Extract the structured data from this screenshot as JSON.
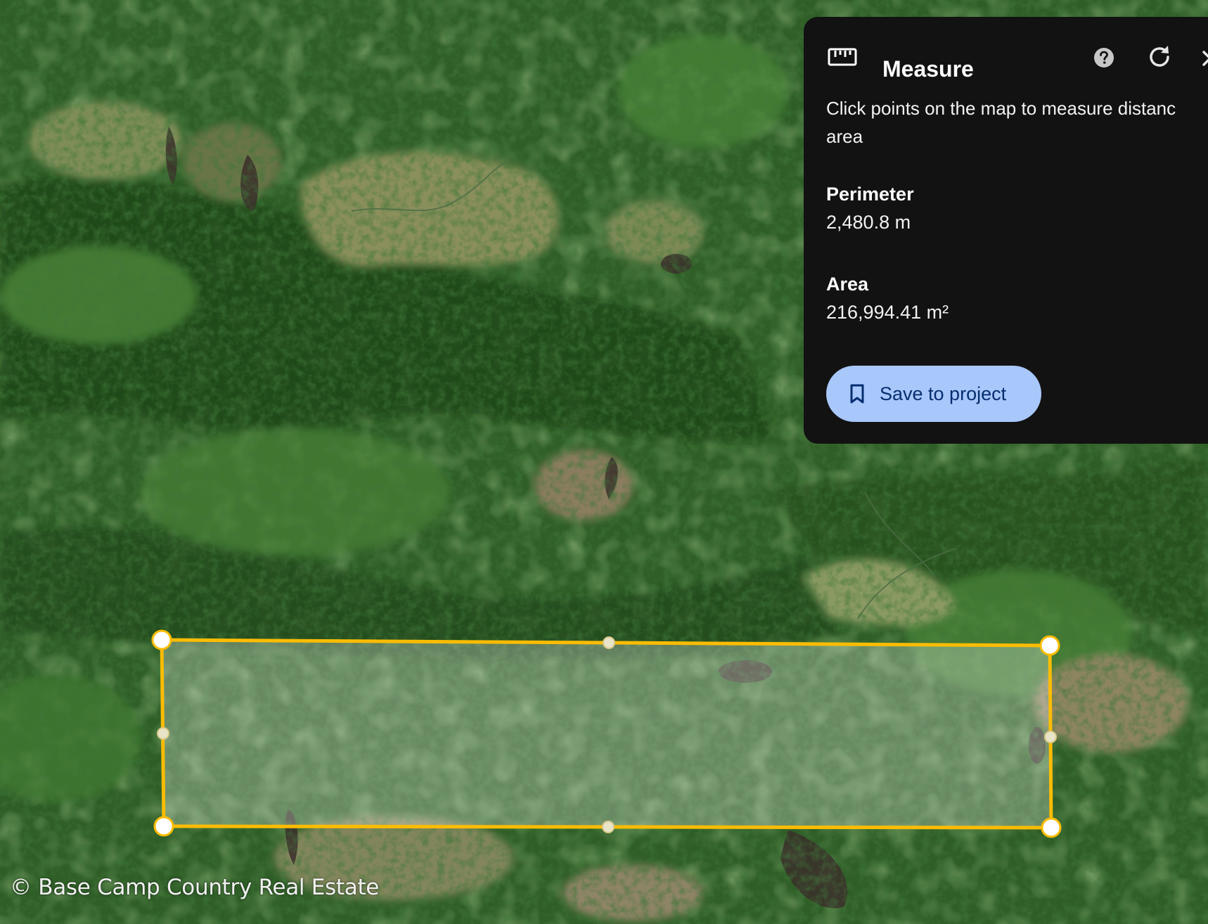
{
  "map": {
    "copyright": "© Base Camp Country Real Estate",
    "measurement_shape": "rectangle",
    "line_color": "#fbbc04",
    "fill_color": "rgba(255,255,255,0.28)"
  },
  "panel": {
    "icon": "ruler-icon",
    "title": "Measure",
    "help_icon": "help-icon",
    "reset_icon": "reset-icon",
    "close_icon": "close-icon",
    "instructions_line1": "Click points on the map to measure distanc",
    "instructions_line2": "area",
    "perimeter_label": "Perimeter",
    "perimeter_value": "2,480.8 m",
    "area_label": "Area",
    "area_value": "216,994.41 m²",
    "save_button": {
      "icon": "bookmark-icon",
      "label": "Save to project",
      "background": "#a8c7fa"
    }
  }
}
